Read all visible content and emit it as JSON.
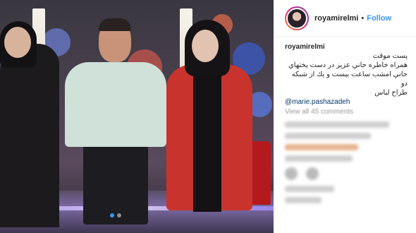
{
  "post": {
    "photo": {
      "carousel_dots": 2,
      "active_dot": 0
    }
  },
  "header": {
    "username": "royamirelmi",
    "separator": "•",
    "follow_label": "Follow"
  },
  "caption": {
    "username": "royamirelmi",
    "lines": [
      "پست موقت",
      "همراه خاطره حاني عزيز در دست پختهاي",
      "حاني امشب ساعت بيست و يك از شبكه دو",
      "طراح لباس"
    ],
    "mention": "@marie.pashazadeh"
  },
  "view_all_comments": "View all 45 comments",
  "colors": {
    "follow": "#3897f0",
    "username": "#262626",
    "muted": "#999999"
  }
}
